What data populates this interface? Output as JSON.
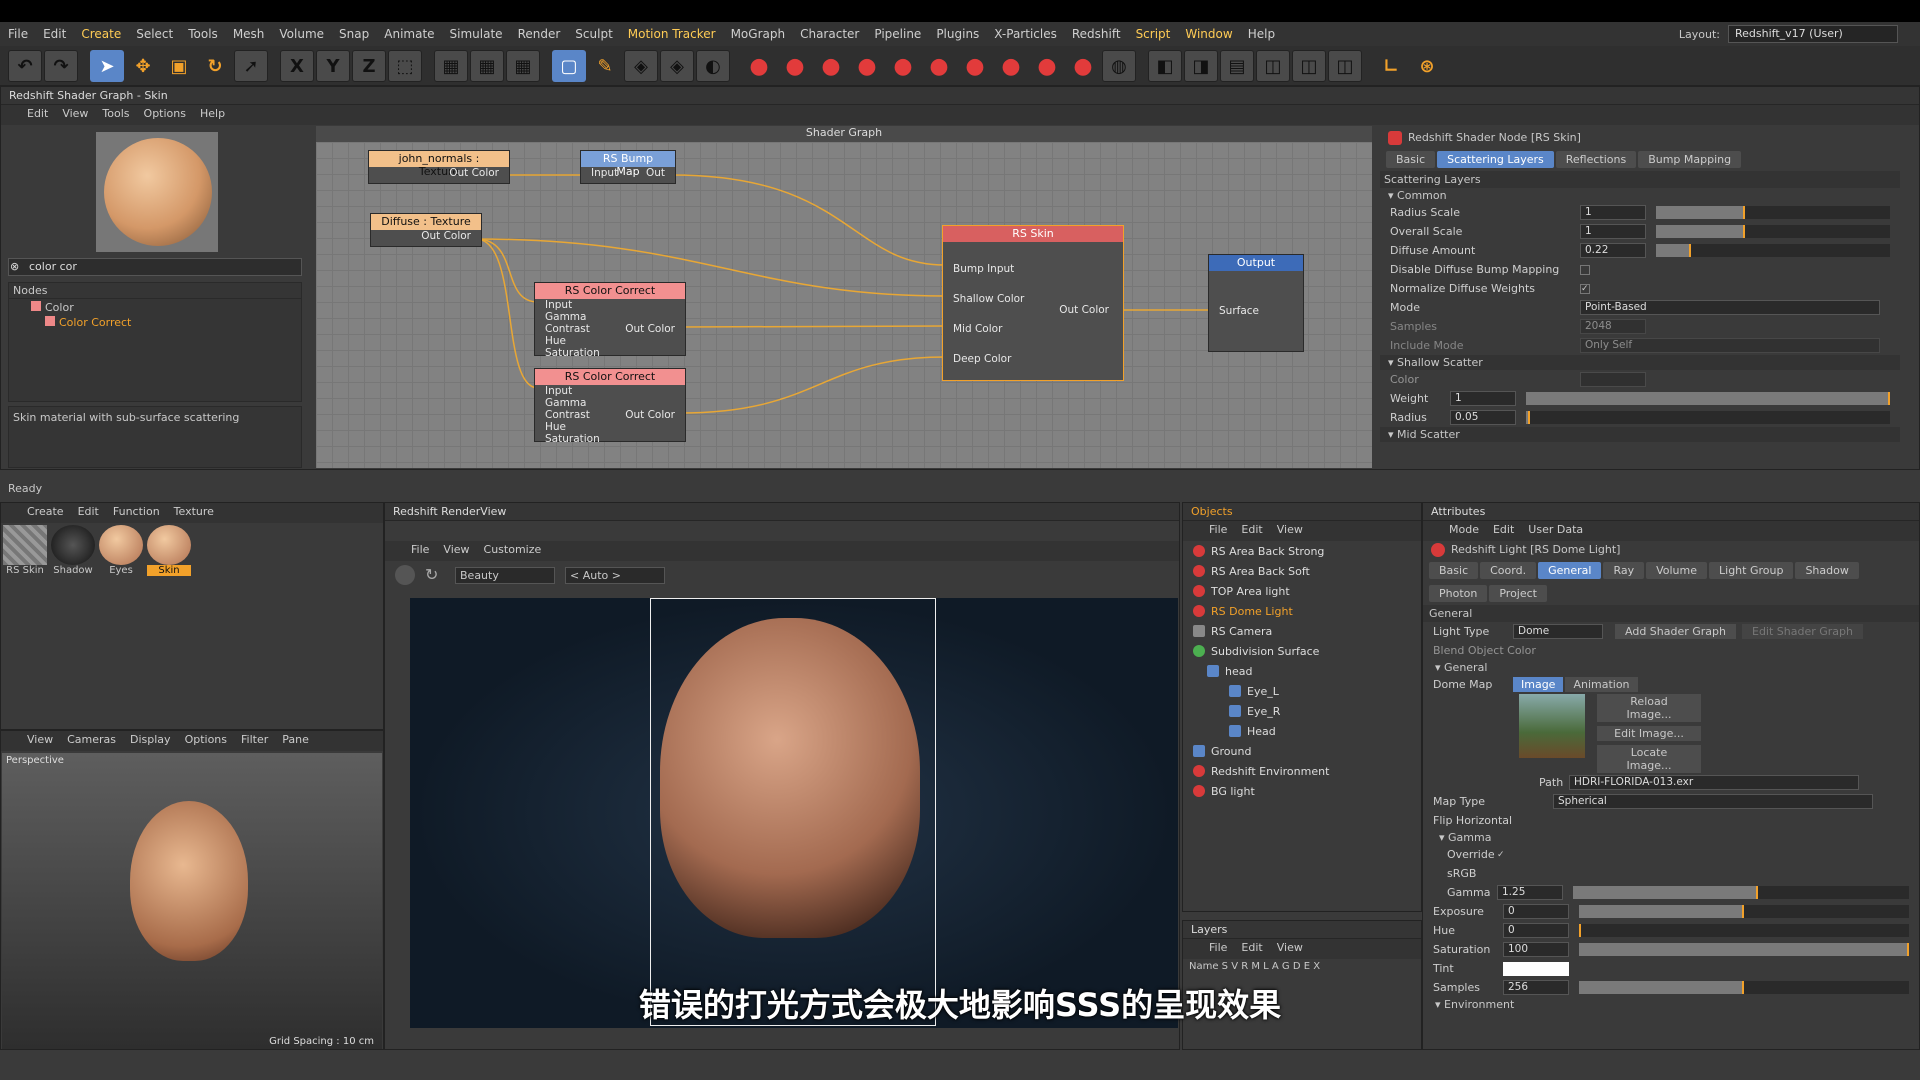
{
  "menu": [
    "File",
    "Edit",
    "Create",
    "Select",
    "Tools",
    "Mesh",
    "Volume",
    "Snap",
    "Animate",
    "Simulate",
    "Render",
    "Sculpt",
    "Motion Tracker",
    "MoGraph",
    "Character",
    "Pipeline",
    "Plugins",
    "X-Particles",
    "Redshift",
    "Script",
    "Window",
    "Help"
  ],
  "layout": {
    "label": "Layout:",
    "value": "Redshift_v17 (User)"
  },
  "shader_window": {
    "title": "Redshift Shader Graph - Skin",
    "menu": [
      "Edit",
      "View",
      "Tools",
      "Options",
      "Help"
    ],
    "search": "color cor",
    "tree_header": "Nodes",
    "tree": [
      "Color",
      "Color Correct"
    ],
    "description": "Skin material with sub-surface scattering",
    "status": "Ready"
  },
  "graph": {
    "title": "Shader Graph",
    "nodes": {
      "normals": {
        "title": "john_normals : Texture",
        "port": "Out Color"
      },
      "bump": {
        "title": "RS Bump Map",
        "in": "Input",
        "out": "Out"
      },
      "diffuse": {
        "title": "Diffuse : Texture",
        "port": "Out Color"
      },
      "cc1": {
        "title": "RS Color Correct",
        "rows": [
          "Input",
          "Gamma",
          "Contrast",
          "Hue",
          "Saturation"
        ],
        "out": "Out Color"
      },
      "cc2": {
        "title": "RS Color Correct",
        "rows": [
          "Input",
          "Gamma",
          "Contrast",
          "Hue",
          "Saturation"
        ],
        "out": "Out Color"
      },
      "skin": {
        "title": "RS Skin",
        "rows": [
          "Bump Input",
          "Shallow Color",
          "Mid Color",
          "Deep Color"
        ],
        "out": "Out Color"
      },
      "output": {
        "title": "Output",
        "in": "Surface"
      }
    }
  },
  "shader_attr": {
    "title": "Redshift Shader Node [RS Skin]",
    "tabs": [
      "Basic",
      "Scattering Layers",
      "Reflections",
      "Bump Mapping"
    ],
    "section": "Scattering Layers",
    "group": "Common",
    "rows": [
      {
        "l": "Radius Scale",
        "v": "1",
        "p": 0.38
      },
      {
        "l": "Overall Scale",
        "v": "1",
        "p": 0.38
      },
      {
        "l": "Diffuse Amount",
        "v": "0.22",
        "p": 0.15
      }
    ],
    "checks": [
      "Disable Diffuse Bump Mapping",
      "Normalize Diffuse Weights"
    ],
    "mode": {
      "l": "Mode",
      "v": "Point-Based"
    },
    "samples": {
      "l": "Samples",
      "v": "2048"
    },
    "include": {
      "l": "Include Mode",
      "v": "Only Self"
    },
    "shallow": "Shallow Scatter",
    "color": "Color",
    "weight": {
      "l": "Weight",
      "v": "1"
    },
    "radius": {
      "l": "Radius",
      "v": "0.05"
    },
    "mid": "Mid Scatter"
  },
  "materials": {
    "menu": [
      "Create",
      "Edit",
      "Function",
      "Texture"
    ],
    "items": [
      "RS Skin",
      "Shadow",
      "Eyes",
      "Skin"
    ]
  },
  "viewport": {
    "menu": [
      "View",
      "Cameras",
      "Display",
      "Options",
      "Filter",
      "Pane"
    ],
    "label": "Perspective",
    "grid": "Grid Spacing : 10 cm"
  },
  "renderview": {
    "title": "Redshift RenderView",
    "menu": [
      "File",
      "View",
      "Customize"
    ],
    "aov": "Beauty",
    "zoom": "< Auto >"
  },
  "objects": {
    "title": "Objects",
    "menu": [
      "File",
      "Edit",
      "View"
    ],
    "items": [
      {
        "n": "RS Area Back Strong",
        "i": "r"
      },
      {
        "n": "RS Area Back Soft",
        "i": "r"
      },
      {
        "n": "TOP Area light",
        "i": "r"
      },
      {
        "n": "RS Dome Light",
        "i": "r",
        "sel": true
      },
      {
        "n": "RS Camera",
        "i": "c"
      },
      {
        "n": "Subdivision Surface",
        "i": "g"
      },
      {
        "n": "head",
        "i": "b"
      },
      {
        "n": "Eye_L",
        "i": "b"
      },
      {
        "n": "Eye_R",
        "i": "b"
      },
      {
        "n": "Head",
        "i": "b"
      },
      {
        "n": "Ground",
        "i": "b"
      },
      {
        "n": "Redshift Environment",
        "i": "r"
      },
      {
        "n": "BG light",
        "i": "r"
      }
    ]
  },
  "layers": {
    "title": "Layers",
    "menu": [
      "File",
      "Edit",
      "View"
    ],
    "cols": "Name  S V R M L A G D E X"
  },
  "attributes": {
    "title": "Attributes",
    "menu": [
      "Mode",
      "Edit",
      "User Data"
    ],
    "obj": "Redshift Light [RS Dome Light]",
    "tabs1": [
      "Basic",
      "Coord.",
      "General",
      "Ray",
      "Volume",
      "Light Group",
      "Shadow"
    ],
    "tabs2": [
      "Photon",
      "Project"
    ],
    "section": "General",
    "light_type": {
      "l": "Light Type",
      "v": "Dome"
    },
    "add_btn": "Add Shader Graph",
    "edit_btn": "Edit Shader Graph",
    "blend": "Blend Object Color",
    "group": "General",
    "dome": "Dome Map",
    "subtabs": [
      "Image",
      "Animation"
    ],
    "buttons": [
      "Reload Image...",
      "Edit Image...",
      "Locate Image..."
    ],
    "path": {
      "l": "Path",
      "v": "HDRI-FLORIDA-013.exr"
    },
    "map_type": {
      "l": "Map Type",
      "v": "Spherical"
    },
    "flip": "Flip Horizontal",
    "gamma_group": "Gamma",
    "override": "Override",
    "srgb": "sRGB",
    "gamma": {
      "l": "Gamma",
      "v": "1.25",
      "p": 0.55
    },
    "exposure": {
      "l": "Exposure",
      "v": "0",
      "p": 0.5
    },
    "hue": {
      "l": "Hue",
      "v": "0",
      "p": 0
    },
    "saturation": {
      "l": "Saturation",
      "v": "100",
      "p": 1
    },
    "tint": "Tint",
    "samples": {
      "l": "Samples",
      "v": "256",
      "p": 0.5
    },
    "env": "Environment"
  },
  "subtitle": "错误的打光方式会极大地影响SSS的呈现效果"
}
